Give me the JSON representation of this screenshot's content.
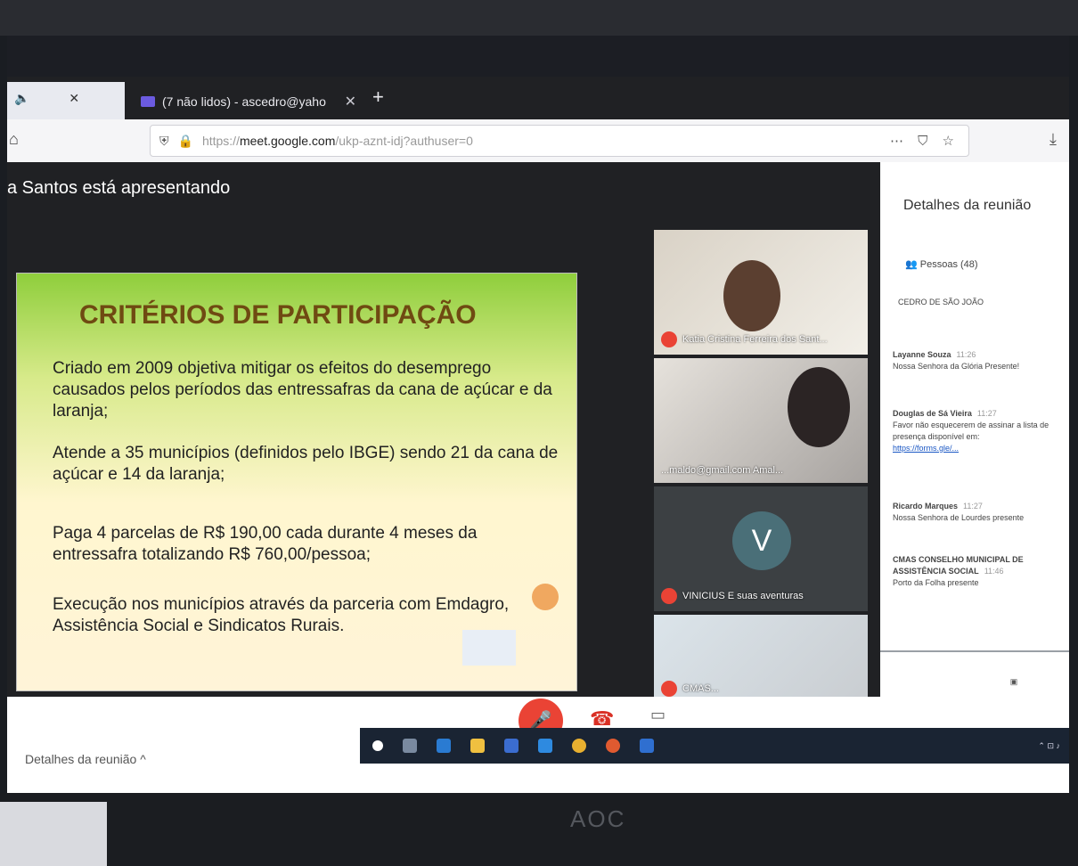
{
  "browser": {
    "active_tab_mute_icon": "speaker-icon",
    "tab_title": "(7 não lidos) - ascedro@yaho",
    "url_host": "meet.google.com",
    "url_prefix": "https://",
    "url_path": "/ukp-aznt-idj?authuser=0"
  },
  "meet": {
    "presenting_text": "a Santos está apresentando",
    "slide": {
      "title": "CRITÉRIOS DE PARTICIPAÇÃO",
      "bullets": [
        "Criado em 2009 objetiva mitigar os efeitos do desemprego causados pelos períodos das entressafras da cana de açúcar e da laranja;",
        "Atende a 35 municípios (definidos pelo IBGE) sendo 21 da cana de açúcar e 14 da laranja;",
        "Paga 4 parcelas de R$ 190,00 cada durante 4 meses da entressafra totalizando R$ 760,00/pessoa;",
        "Execução nos municípios através da parceria com Emdagro, Assistência Social e Sindicatos Rurais."
      ]
    },
    "tiles": [
      {
        "name": "Katia Cristina Ferreira dos Sant..."
      },
      {
        "name": "...maldo@gmail.com Amal..."
      },
      {
        "name": "VINICIUS E suas aventuras",
        "initial": "V"
      },
      {
        "name": "CMAS..."
      }
    ]
  },
  "panel": {
    "title": "Detalhes da reunião",
    "people_label": "Pessoas (48)",
    "org": "CEDRO DE SÃO JOÃO",
    "messages": [
      {
        "who": "Layanne Souza",
        "time": "11:26",
        "text": "Nossa Senhora da Glória Presente!"
      },
      {
        "who": "Douglas de Sá Vieira",
        "time": "11:27",
        "text": "Favor não esquecerem de assinar a lista de presença disponível em:",
        "link": "https://forms.gle/..."
      },
      {
        "who": "Ricardo Marques",
        "time": "11:27",
        "text": "Nossa Senhora de Lourdes presente"
      },
      {
        "who": "CMAS CONSELHO MUNICIPAL DE ASSISTÊNCIA SOCIAL",
        "time": "11:46",
        "text": "Porto da Folha presente"
      }
    ]
  },
  "controls": {
    "meet_details_label": "Detalhes da reunião ^"
  },
  "monitor": {
    "brand": "AOC"
  }
}
